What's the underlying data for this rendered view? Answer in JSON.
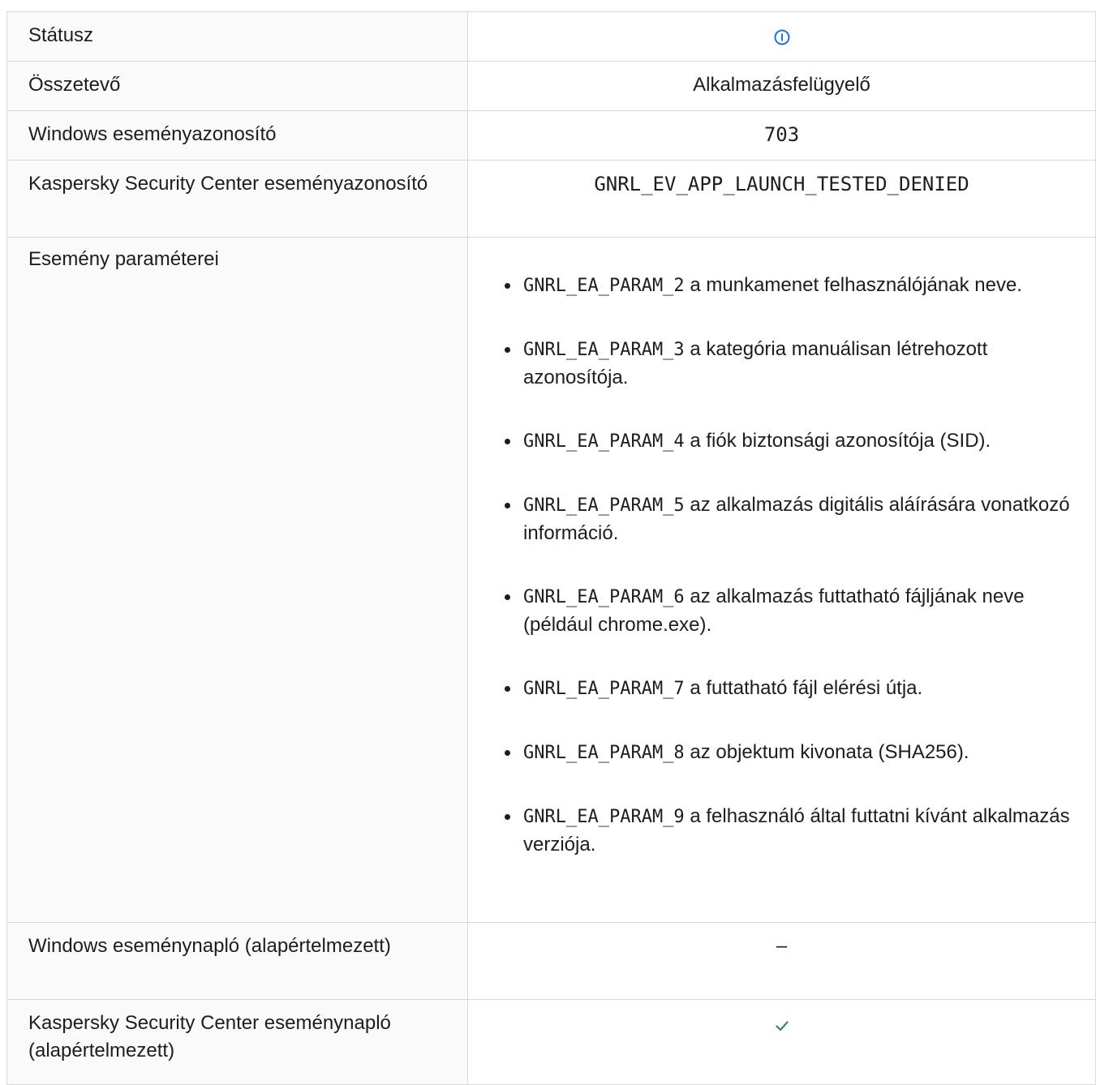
{
  "rows": {
    "status": {
      "label": "Státusz",
      "icon": "info-circle-icon",
      "icon_color": "#1a73e8"
    },
    "component": {
      "label": "Összetevő",
      "value": "Alkalmazásfelügyelő"
    },
    "windows_event_id": {
      "label": "Windows eseményazonosító",
      "value": "703"
    },
    "ksc_event_id": {
      "label": "Kaspersky Security Center eseményazonosító",
      "value": "GNRL_EV_APP_LAUNCH_TESTED_DENIED"
    },
    "event_parameters": {
      "label": "Esemény paraméterei",
      "items": [
        {
          "code": "GNRL_EA_PARAM_2",
          "text": "a munkamenet felhasználójának neve."
        },
        {
          "code": "GNRL_EA_PARAM_3",
          "text": "a kategória manuálisan létrehozott azonosítója."
        },
        {
          "code": "GNRL_EA_PARAM_4",
          "text": "a fiók biztonsági azonosítója (SID)."
        },
        {
          "code": "GNRL_EA_PARAM_5",
          "text": "az alkalmazás digitális aláírására vonatkozó információ."
        },
        {
          "code": "GNRL_EA_PARAM_6",
          "text": "az alkalmazás futtatható fájljának neve (például chrome.exe)."
        },
        {
          "code": "GNRL_EA_PARAM_7",
          "text": "a futtatható fájl elérési útja."
        },
        {
          "code": "GNRL_EA_PARAM_8",
          "text": "az objektum kivonata (SHA256)."
        },
        {
          "code": "GNRL_EA_PARAM_9",
          "text": "a felhasználó által futtatni kívánt alkalmazás verziója."
        }
      ]
    },
    "windows_event_log": {
      "label": "Windows eseménynapló (alapértelmezett)",
      "value": "–"
    },
    "ksc_event_log": {
      "label": "Kaspersky Security Center eseménynapló (alapértelmezett)",
      "icon": "checkmark-icon",
      "icon_color": "#2e8b57"
    }
  }
}
